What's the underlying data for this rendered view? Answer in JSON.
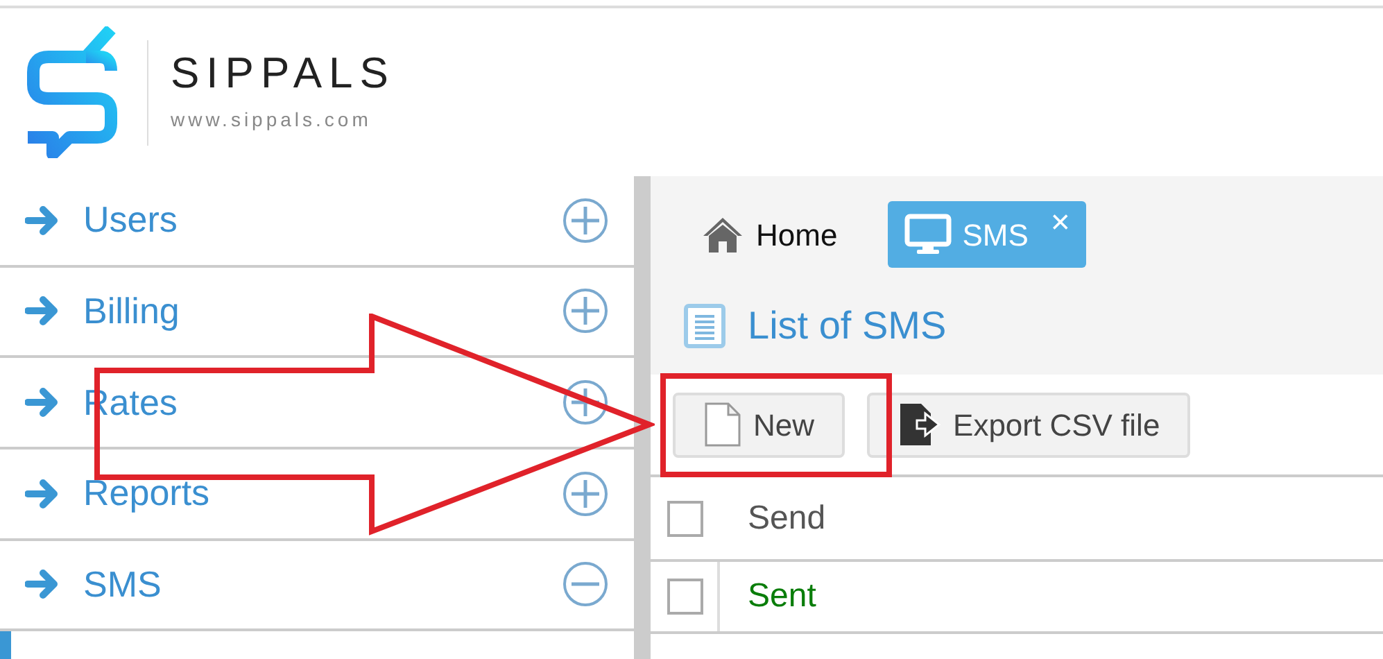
{
  "logo": {
    "name": "SIPPALS",
    "url": "www.sippals.com"
  },
  "sidebar": {
    "items": [
      {
        "label": "Users",
        "expanded": false
      },
      {
        "label": "Billing",
        "expanded": false
      },
      {
        "label": "Rates",
        "expanded": false
      },
      {
        "label": "Reports",
        "expanded": false
      },
      {
        "label": "SMS",
        "expanded": true
      }
    ]
  },
  "tabs": [
    {
      "label": "Home",
      "kind": "home",
      "selected": false,
      "closable": false
    },
    {
      "label": "SMS",
      "kind": "screen",
      "selected": true,
      "closable": true,
      "close": "×"
    }
  ],
  "page_title": "List of SMS",
  "buttons": [
    {
      "label": "New",
      "kind": "new"
    },
    {
      "label": "Export CSV file",
      "kind": "export"
    }
  ],
  "table": {
    "columns": [
      "Send"
    ],
    "header_checked": false,
    "rows": [
      {
        "status": "Sent",
        "checked": false
      }
    ]
  }
}
